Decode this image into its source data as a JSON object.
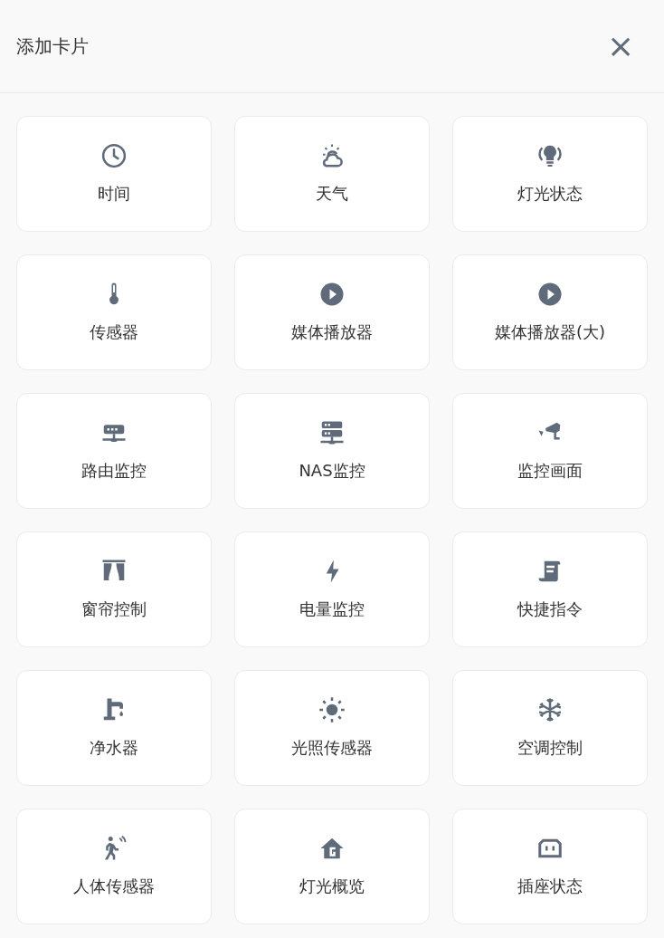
{
  "dialog": {
    "title": "添加卡片",
    "close": "×"
  },
  "cards": [
    {
      "kind": "clock",
      "label": "时间"
    },
    {
      "kind": "weather",
      "label": "天气"
    },
    {
      "kind": "bulb",
      "label": "灯光状态"
    },
    {
      "kind": "thermometer",
      "label": "传感器"
    },
    {
      "kind": "play",
      "label": "媒体播放器"
    },
    {
      "kind": "play",
      "label": "媒体播放器(大)"
    },
    {
      "kind": "router",
      "label": "路由监控"
    },
    {
      "kind": "server",
      "label": "NAS监控"
    },
    {
      "kind": "camera",
      "label": "监控画面"
    },
    {
      "kind": "curtains",
      "label": "窗帘控制"
    },
    {
      "kind": "bolt",
      "label": "电量监控"
    },
    {
      "kind": "script",
      "label": "快捷指令"
    },
    {
      "kind": "faucet",
      "label": "净水器"
    },
    {
      "kind": "sun",
      "label": "光照传感器"
    },
    {
      "kind": "snowflake",
      "label": "空调控制"
    },
    {
      "kind": "motion",
      "label": "人体传感器"
    },
    {
      "kind": "home",
      "label": "灯光概览"
    },
    {
      "kind": "socket",
      "label": "插座状态"
    }
  ]
}
